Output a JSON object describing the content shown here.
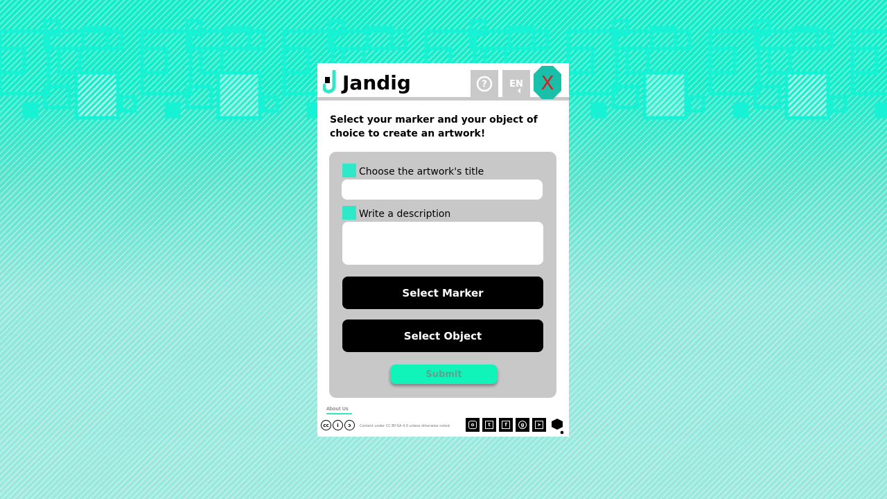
{
  "app": {
    "name": "Jandig"
  },
  "header": {
    "language_label": "EN",
    "close_label": "X"
  },
  "intro": {
    "text": "Select your marker and your object of choice to create an artwork!"
  },
  "form": {
    "title_label": "Choose the artwork's title",
    "title_value": "",
    "description_label": "Write a description",
    "description_value": "",
    "select_marker_label": "Select Marker",
    "select_object_label": "Select Object",
    "submit_label": "Submit"
  },
  "footer": {
    "about_label": "About Us",
    "license_text": "Content under CC BY-SA 4.0 unless otherwise noted.",
    "social_icons": [
      "instagram-icon",
      "twitter-icon",
      "facebook-icon",
      "github-icon",
      "telegram-icon"
    ]
  },
  "colors": {
    "accent": "#2fe8c8",
    "close_bg": "#1abfa9",
    "close_x": "#d7201f",
    "submit_bg": "#10f3b9",
    "form_bg": "#c8c8c8"
  }
}
